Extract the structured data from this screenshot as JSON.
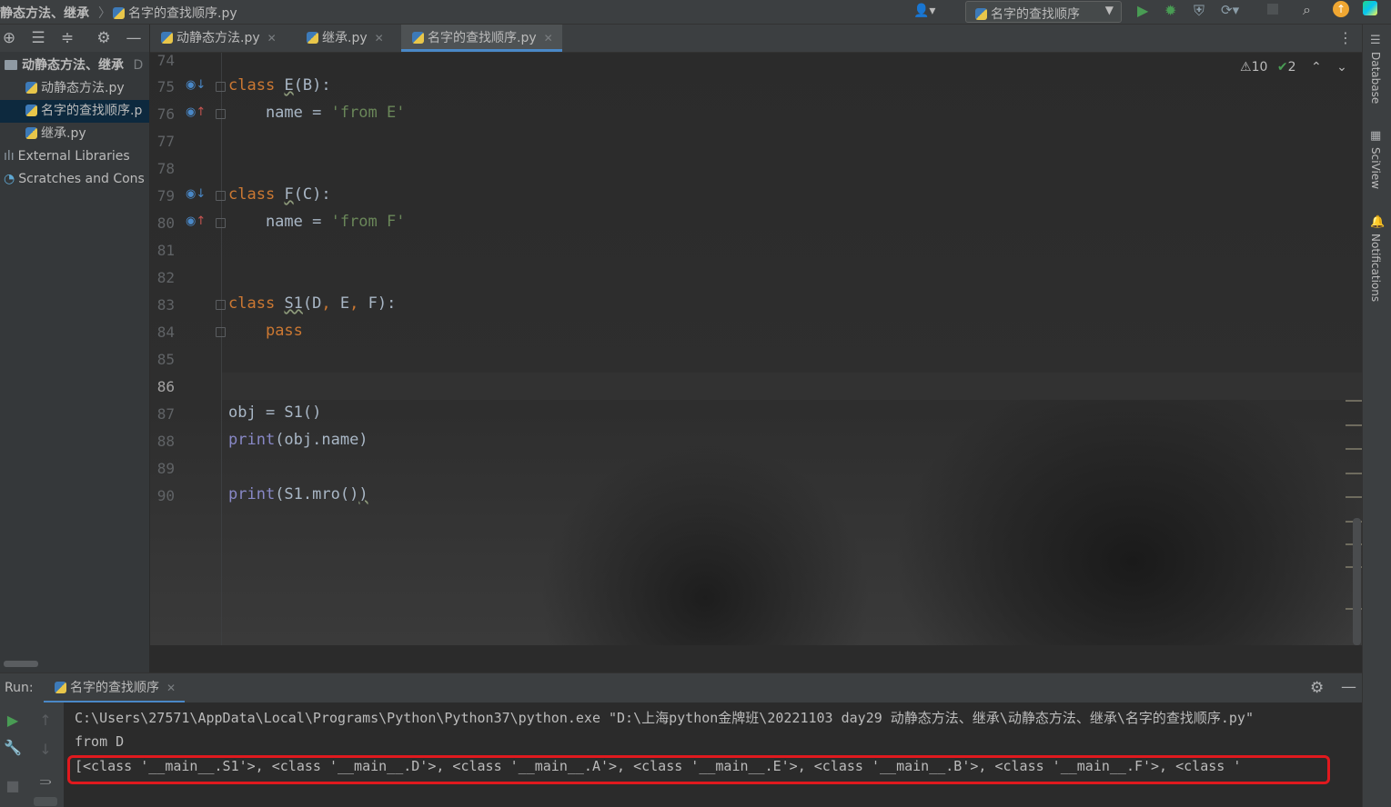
{
  "nav": {
    "project": "静态方法、继承",
    "file": "名字的查找顺序.py",
    "run_config": "名字的查找顺序"
  },
  "project_tree": [
    {
      "label": "动静态方法、继承",
      "suffix": "D"
    },
    {
      "label": "动静态方法.py"
    },
    {
      "label": "名字的查找顺序.p"
    },
    {
      "label": "继承.py"
    },
    {
      "label": "External Libraries"
    },
    {
      "label": "Scratches and Cons"
    }
  ],
  "tabs": [
    {
      "label": "动静态方法.py",
      "active": false
    },
    {
      "label": "继承.py",
      "active": false
    },
    {
      "label": "名字的查找顺序.py",
      "active": true
    }
  ],
  "inspections": {
    "warnings": "10",
    "weak_warnings": "2"
  },
  "editor": {
    "line_numbers": [
      "74",
      "75",
      "76",
      "77",
      "78",
      "79",
      "80",
      "81",
      "82",
      "83",
      "84",
      "85",
      "86",
      "87",
      "88",
      "89",
      "90"
    ],
    "current_line": "86"
  },
  "right_strip": {
    "database": "Database",
    "sciview": "SciView",
    "notifications": "Notifications"
  },
  "run_panel": {
    "label": "Run:",
    "tab": "名字的查找顺序",
    "console": [
      "C:\\Users\\27571\\AppData\\Local\\Programs\\Python\\Python37\\python.exe \"D:\\上海python金牌班\\20221103 day29 动静态方法、继承\\动静态方法、继承\\名字的查找顺序.py\"",
      "from D",
      "[<class '__main__.S1'>, <class '__main__.D'>, <class '__main__.A'>, <class '__main__.E'>, <class '__main__.B'>, <class '__main__.F'>, <class '"
    ]
  },
  "colors": {
    "keyword": "#cc7832",
    "string": "#6a8759",
    "builtin": "#8888c6",
    "highlight_box": "#e0191e",
    "tab_underline": "#4a88c7"
  }
}
